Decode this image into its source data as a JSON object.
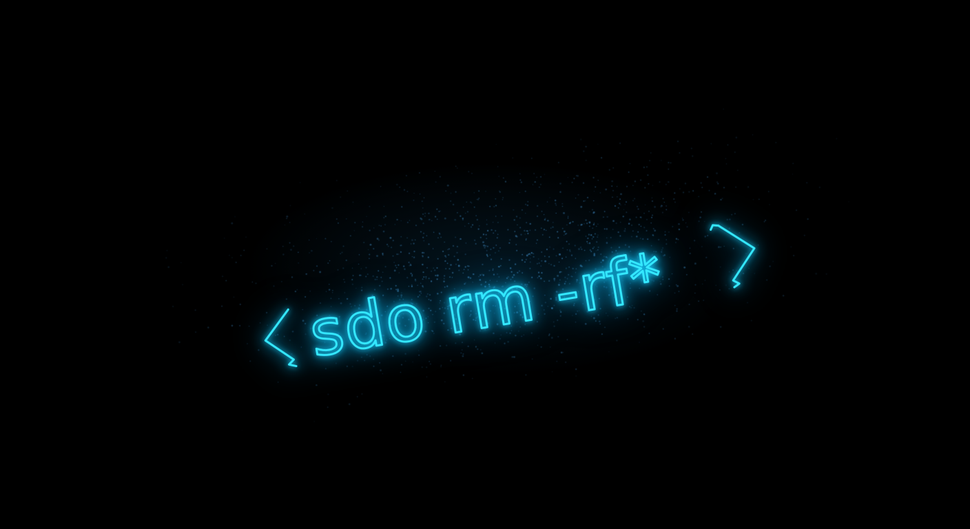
{
  "scene": {
    "background_color": "#000000",
    "neon_color": "#2ee6ff",
    "particle_color": "#3a8fc4"
  },
  "sign": {
    "open_bracket": "<",
    "command": "sdo rm -rf*",
    "close_bracket": ">"
  }
}
